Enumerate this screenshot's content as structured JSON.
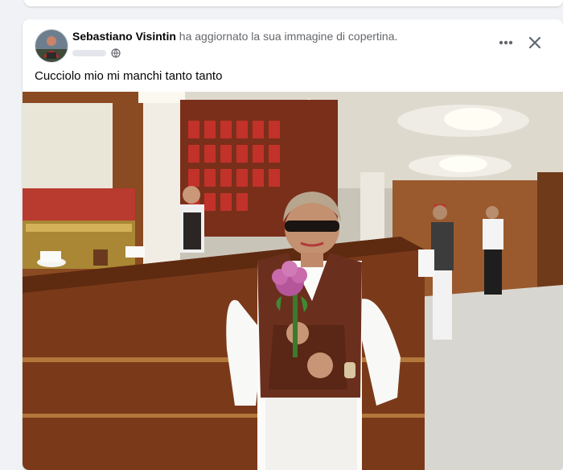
{
  "post": {
    "author": "Sebastiano Visintin",
    "action": "ha aggiornato la sua immagine di copertina.",
    "caption": "Cucciolo mio mi manchi tanto tanto"
  },
  "icons": {
    "privacy": "globe-icon",
    "more": "more-horizontal-icon",
    "close": "close-icon"
  },
  "colors": {
    "author_text": "#050505",
    "secondary_text": "#65676b",
    "card_bg": "#ffffff",
    "page_bg": "#f0f2f5"
  }
}
